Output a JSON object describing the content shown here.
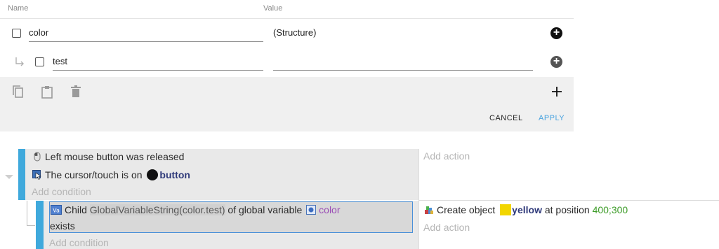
{
  "variables_editor": {
    "columns": {
      "name": "Name",
      "value": "Value"
    },
    "rows": [
      {
        "name": "color",
        "value": "(Structure)"
      },
      {
        "name": "test",
        "value": ""
      }
    ],
    "add_icon": "plus-icon",
    "buttons": {
      "cancel": "CANCEL",
      "apply": "APPLY"
    },
    "colors": {
      "apply": "#4aa3df",
      "toolbar_bg": "#f0f0f0"
    }
  },
  "event_sheet": {
    "event1": {
      "conditions": [
        {
          "icon": "mouse-icon",
          "text": "Left mouse button was released"
        },
        {
          "icon": "cursor-on-object-icon",
          "prefix": "The cursor/touch is on",
          "object": "button"
        }
      ],
      "add_condition": "Add condition",
      "add_action": "Add action"
    },
    "event2": {
      "condition": {
        "icon": "variable-icon",
        "part1": "Child",
        "expression": "GlobalVariableString(color.test)",
        "part2": "of global variable",
        "variable": "color",
        "part3": "exists"
      },
      "action": {
        "icon": "create-object-icon",
        "prefix": "Create object",
        "object": "yellow",
        "mid": "at position",
        "position": "400;300"
      },
      "add_condition": "Add condition",
      "add_action": "Add action"
    },
    "colors": {
      "event_bar": "#3fa9dc",
      "object_swatch": "#f2d600",
      "position": "#3c9b27",
      "variable": "#9a4db6"
    }
  }
}
